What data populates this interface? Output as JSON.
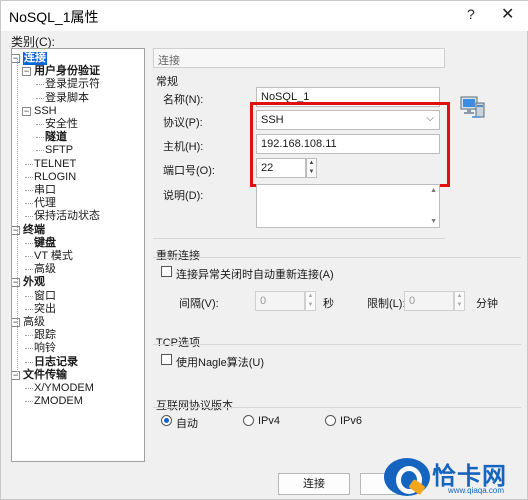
{
  "window": {
    "title": "NoSQL_1属性",
    "help": "?",
    "close": "✕"
  },
  "category_label": "类别(C):",
  "tree": [
    {
      "label": "连接",
      "bold": true,
      "selected": true,
      "expander": "−"
    },
    {
      "label": "用户身份验证",
      "bold": true,
      "expander": "−"
    },
    {
      "label": "登录提示符"
    },
    {
      "label": "登录脚本"
    },
    {
      "label": "SSH",
      "expander": "−"
    },
    {
      "label": "安全性"
    },
    {
      "label": "隧道",
      "bold": true
    },
    {
      "label": "SFTP"
    },
    {
      "label": "TELNET"
    },
    {
      "label": "RLOGIN"
    },
    {
      "label": "串口"
    },
    {
      "label": "代理"
    },
    {
      "label": "保持活动状态"
    },
    {
      "label": "终端",
      "bold": true,
      "expander": "−"
    },
    {
      "label": "键盘",
      "bold": true
    },
    {
      "label": "VT 模式"
    },
    {
      "label": "高级"
    },
    {
      "label": "外观",
      "bold": true,
      "expander": "−"
    },
    {
      "label": "窗口"
    },
    {
      "label": "突出"
    },
    {
      "label": "高级",
      "expander": "−"
    },
    {
      "label": "跟踪"
    },
    {
      "label": "响铃"
    },
    {
      "label": "日志记录",
      "bold": true
    },
    {
      "label": "文件传输",
      "bold": true,
      "expander": "−"
    },
    {
      "label": "X/YMODEM"
    },
    {
      "label": "ZMODEM"
    }
  ],
  "panel_header": "连接",
  "general": {
    "title": "常规",
    "name_label": "名称(N):",
    "name_value": "NoSQL_1",
    "protocol_label": "协议(P):",
    "protocol_value": "SSH",
    "host_label": "主机(H):",
    "host_value": "192.168.108.11",
    "port_label": "端口号(O):",
    "port_value": "22",
    "desc_label": "说明(D):"
  },
  "reconnect": {
    "title": "重新连接",
    "checkbox_label": "连接异常关闭时自动重新连接(A)",
    "interval_label": "间隔(V):",
    "interval_value": "0",
    "interval_unit": "秒",
    "limit_label": "限制(L):",
    "limit_value": "0",
    "limit_unit": "分钟"
  },
  "tcp": {
    "title": "TCP选项",
    "checkbox_label": "使用Nagle算法(U)"
  },
  "ip_version": {
    "title": "互联网协议版本",
    "options": [
      "自动",
      "IPv4",
      "IPv6"
    ],
    "selected": "自动"
  },
  "buttons": {
    "connect": "连接"
  },
  "watermark": {
    "text": "恰卡网",
    "url": "www.qiaqa.com"
  }
}
